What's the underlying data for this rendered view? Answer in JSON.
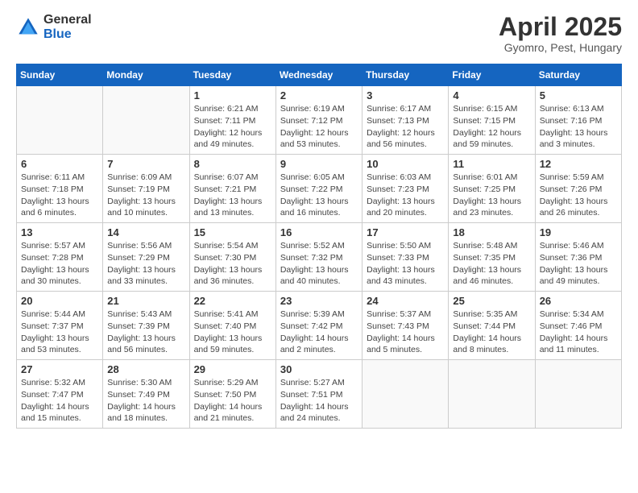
{
  "logo": {
    "general": "General",
    "blue": "Blue"
  },
  "title": "April 2025",
  "subtitle": "Gyomro, Pest, Hungary",
  "header": {
    "days": [
      "Sunday",
      "Monday",
      "Tuesday",
      "Wednesday",
      "Thursday",
      "Friday",
      "Saturday"
    ]
  },
  "weeks": [
    {
      "alt": false,
      "days": [
        {
          "day": "",
          "info": ""
        },
        {
          "day": "",
          "info": ""
        },
        {
          "day": "1",
          "info": "Sunrise: 6:21 AM\nSunset: 7:11 PM\nDaylight: 12 hours and 49 minutes."
        },
        {
          "day": "2",
          "info": "Sunrise: 6:19 AM\nSunset: 7:12 PM\nDaylight: 12 hours and 53 minutes."
        },
        {
          "day": "3",
          "info": "Sunrise: 6:17 AM\nSunset: 7:13 PM\nDaylight: 12 hours and 56 minutes."
        },
        {
          "day": "4",
          "info": "Sunrise: 6:15 AM\nSunset: 7:15 PM\nDaylight: 12 hours and 59 minutes."
        },
        {
          "day": "5",
          "info": "Sunrise: 6:13 AM\nSunset: 7:16 PM\nDaylight: 13 hours and 3 minutes."
        }
      ]
    },
    {
      "alt": true,
      "days": [
        {
          "day": "6",
          "info": "Sunrise: 6:11 AM\nSunset: 7:18 PM\nDaylight: 13 hours and 6 minutes."
        },
        {
          "day": "7",
          "info": "Sunrise: 6:09 AM\nSunset: 7:19 PM\nDaylight: 13 hours and 10 minutes."
        },
        {
          "day": "8",
          "info": "Sunrise: 6:07 AM\nSunset: 7:21 PM\nDaylight: 13 hours and 13 minutes."
        },
        {
          "day": "9",
          "info": "Sunrise: 6:05 AM\nSunset: 7:22 PM\nDaylight: 13 hours and 16 minutes."
        },
        {
          "day": "10",
          "info": "Sunrise: 6:03 AM\nSunset: 7:23 PM\nDaylight: 13 hours and 20 minutes."
        },
        {
          "day": "11",
          "info": "Sunrise: 6:01 AM\nSunset: 7:25 PM\nDaylight: 13 hours and 23 minutes."
        },
        {
          "day": "12",
          "info": "Sunrise: 5:59 AM\nSunset: 7:26 PM\nDaylight: 13 hours and 26 minutes."
        }
      ]
    },
    {
      "alt": false,
      "days": [
        {
          "day": "13",
          "info": "Sunrise: 5:57 AM\nSunset: 7:28 PM\nDaylight: 13 hours and 30 minutes."
        },
        {
          "day": "14",
          "info": "Sunrise: 5:56 AM\nSunset: 7:29 PM\nDaylight: 13 hours and 33 minutes."
        },
        {
          "day": "15",
          "info": "Sunrise: 5:54 AM\nSunset: 7:30 PM\nDaylight: 13 hours and 36 minutes."
        },
        {
          "day": "16",
          "info": "Sunrise: 5:52 AM\nSunset: 7:32 PM\nDaylight: 13 hours and 40 minutes."
        },
        {
          "day": "17",
          "info": "Sunrise: 5:50 AM\nSunset: 7:33 PM\nDaylight: 13 hours and 43 minutes."
        },
        {
          "day": "18",
          "info": "Sunrise: 5:48 AM\nSunset: 7:35 PM\nDaylight: 13 hours and 46 minutes."
        },
        {
          "day": "19",
          "info": "Sunrise: 5:46 AM\nSunset: 7:36 PM\nDaylight: 13 hours and 49 minutes."
        }
      ]
    },
    {
      "alt": true,
      "days": [
        {
          "day": "20",
          "info": "Sunrise: 5:44 AM\nSunset: 7:37 PM\nDaylight: 13 hours and 53 minutes."
        },
        {
          "day": "21",
          "info": "Sunrise: 5:43 AM\nSunset: 7:39 PM\nDaylight: 13 hours and 56 minutes."
        },
        {
          "day": "22",
          "info": "Sunrise: 5:41 AM\nSunset: 7:40 PM\nDaylight: 13 hours and 59 minutes."
        },
        {
          "day": "23",
          "info": "Sunrise: 5:39 AM\nSunset: 7:42 PM\nDaylight: 14 hours and 2 minutes."
        },
        {
          "day": "24",
          "info": "Sunrise: 5:37 AM\nSunset: 7:43 PM\nDaylight: 14 hours and 5 minutes."
        },
        {
          "day": "25",
          "info": "Sunrise: 5:35 AM\nSunset: 7:44 PM\nDaylight: 14 hours and 8 minutes."
        },
        {
          "day": "26",
          "info": "Sunrise: 5:34 AM\nSunset: 7:46 PM\nDaylight: 14 hours and 11 minutes."
        }
      ]
    },
    {
      "alt": false,
      "days": [
        {
          "day": "27",
          "info": "Sunrise: 5:32 AM\nSunset: 7:47 PM\nDaylight: 14 hours and 15 minutes."
        },
        {
          "day": "28",
          "info": "Sunrise: 5:30 AM\nSunset: 7:49 PM\nDaylight: 14 hours and 18 minutes."
        },
        {
          "day": "29",
          "info": "Sunrise: 5:29 AM\nSunset: 7:50 PM\nDaylight: 14 hours and 21 minutes."
        },
        {
          "day": "30",
          "info": "Sunrise: 5:27 AM\nSunset: 7:51 PM\nDaylight: 14 hours and 24 minutes."
        },
        {
          "day": "",
          "info": ""
        },
        {
          "day": "",
          "info": ""
        },
        {
          "day": "",
          "info": ""
        }
      ]
    }
  ]
}
